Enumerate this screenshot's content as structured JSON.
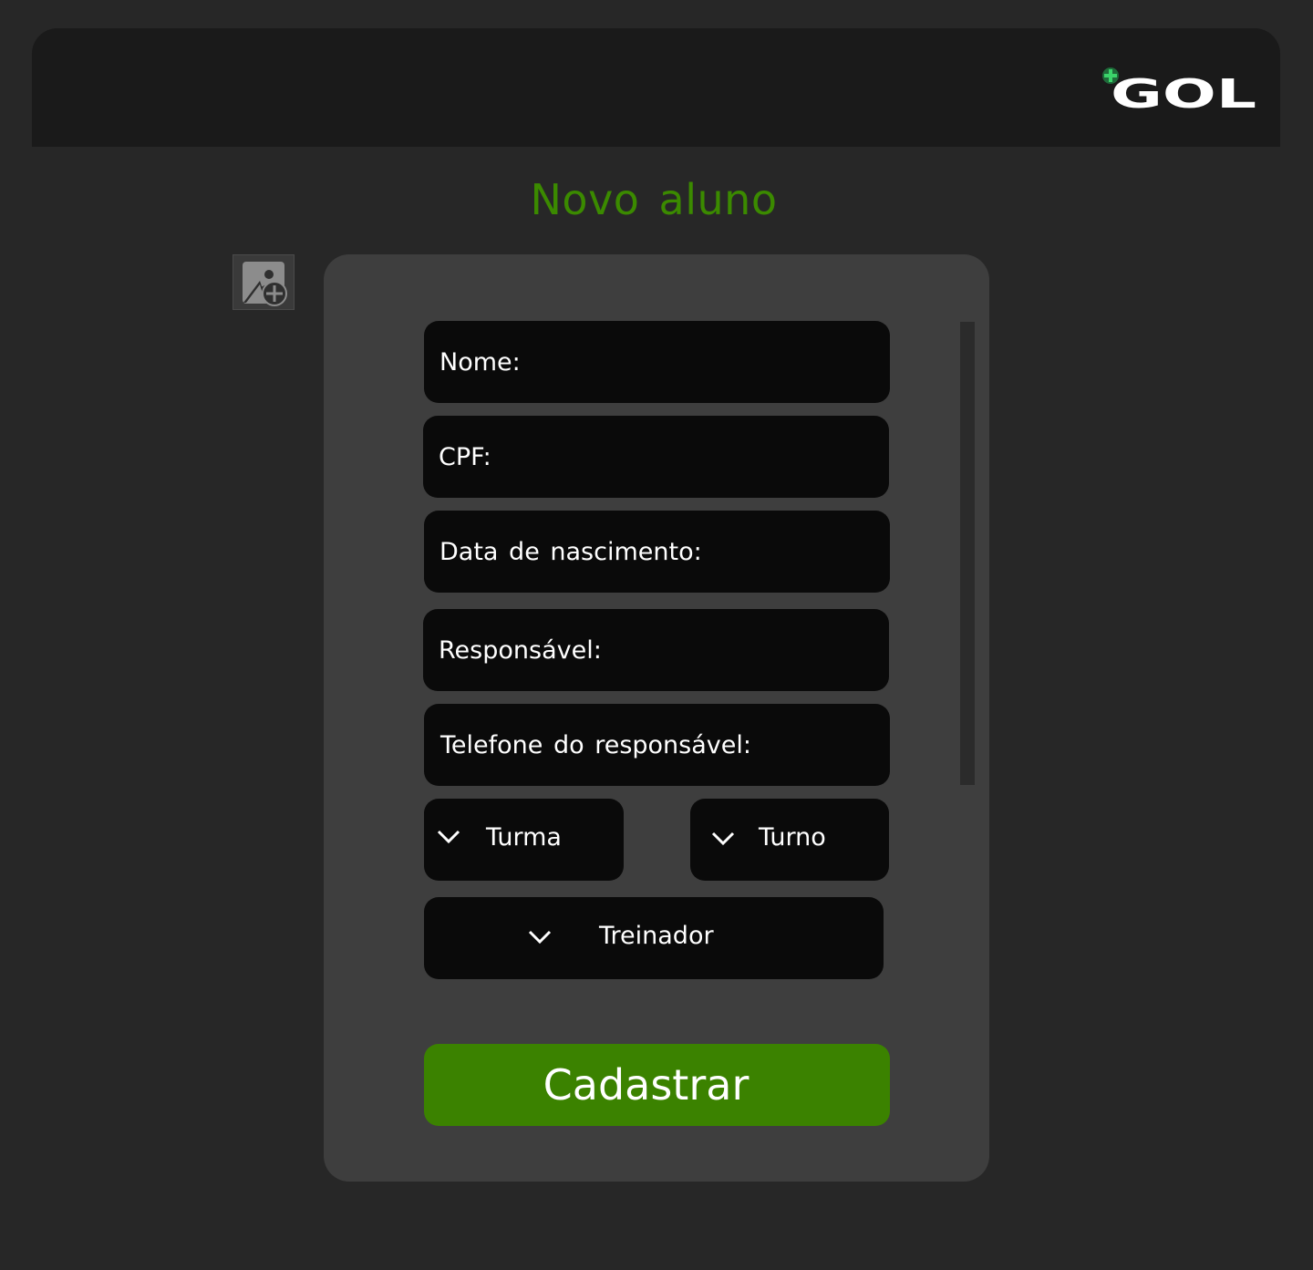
{
  "header": {
    "logo_text": "GOL",
    "logo_plus_color": "#1f6b3a"
  },
  "page": {
    "title": "Novo aluno"
  },
  "photo_upload": {
    "icon": "add-image-icon"
  },
  "form": {
    "fields": {
      "name": "Nome:",
      "cpf": "CPF:",
      "birth_date": "Data de nascimento:",
      "guardian": "Responsável:",
      "guardian_phone": "Telefone do responsável:"
    },
    "selects": {
      "class": "Turma",
      "shift": "Turno",
      "trainer": "Treinador"
    },
    "submit_label": "Cadastrar"
  },
  "colors": {
    "accent": "#3b8200",
    "title": "#3b8a00",
    "background": "#272727",
    "card": "#3e3e3e",
    "field": "#0a0a0a"
  }
}
